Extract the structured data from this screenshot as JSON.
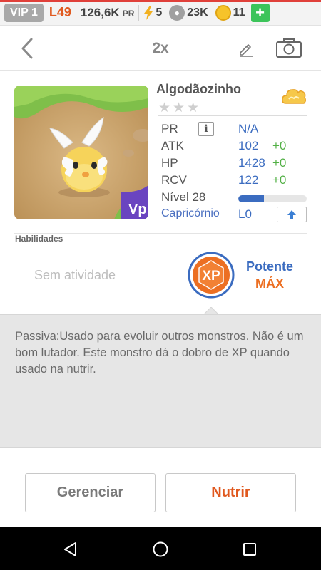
{
  "statusbar": {
    "vip": "VIP 1",
    "level": "L49",
    "power": "126,6K",
    "power_unit": "PR",
    "energy": "5",
    "food": "23K",
    "coins": "11",
    "add_label": "+",
    "energy_icon": "lightning-icon",
    "food_icon": "paw-icon",
    "coin_icon": "coin-icon"
  },
  "header": {
    "title": "2x",
    "back_icon": "chevron-left-icon",
    "edit_icon": "pencil-icon",
    "camera_icon": "camera-icon"
  },
  "monster": {
    "name": "Algodãozinho",
    "stars": [
      "★",
      "★",
      "★"
    ],
    "element_icon": "cloud-element-icon",
    "portrait_badge": "Vp",
    "stats": {
      "pr": {
        "label": "PR",
        "value": "N/A"
      },
      "atk": {
        "label": "ATK",
        "value": "102",
        "bonus": "+0"
      },
      "hp": {
        "label": "HP",
        "value": "1428",
        "bonus": "+0"
      },
      "rcv": {
        "label": "RCV",
        "value": "122",
        "bonus": "+0"
      },
      "level": {
        "label": "Nível 28",
        "progress": 0.38
      },
      "sign": {
        "label": "Capricórnio",
        "value": "L0"
      }
    }
  },
  "skills": {
    "heading": "Habilidades",
    "active": "Sem atividade",
    "passive_badge": "XP",
    "passive_name": "Potente",
    "passive_level": "MÁX",
    "description": "Passiva:Usado para evoluir outros monstros. Não é um bom lutador. Este monstro dá o dobro de XP quando usado na nutrir."
  },
  "actions": {
    "manage": "Gerenciar",
    "feed": "Nutrir"
  },
  "colors": {
    "accent_blue": "#3b6cc0",
    "accent_orange": "#ec6f22",
    "bonus_green": "#52b045"
  }
}
